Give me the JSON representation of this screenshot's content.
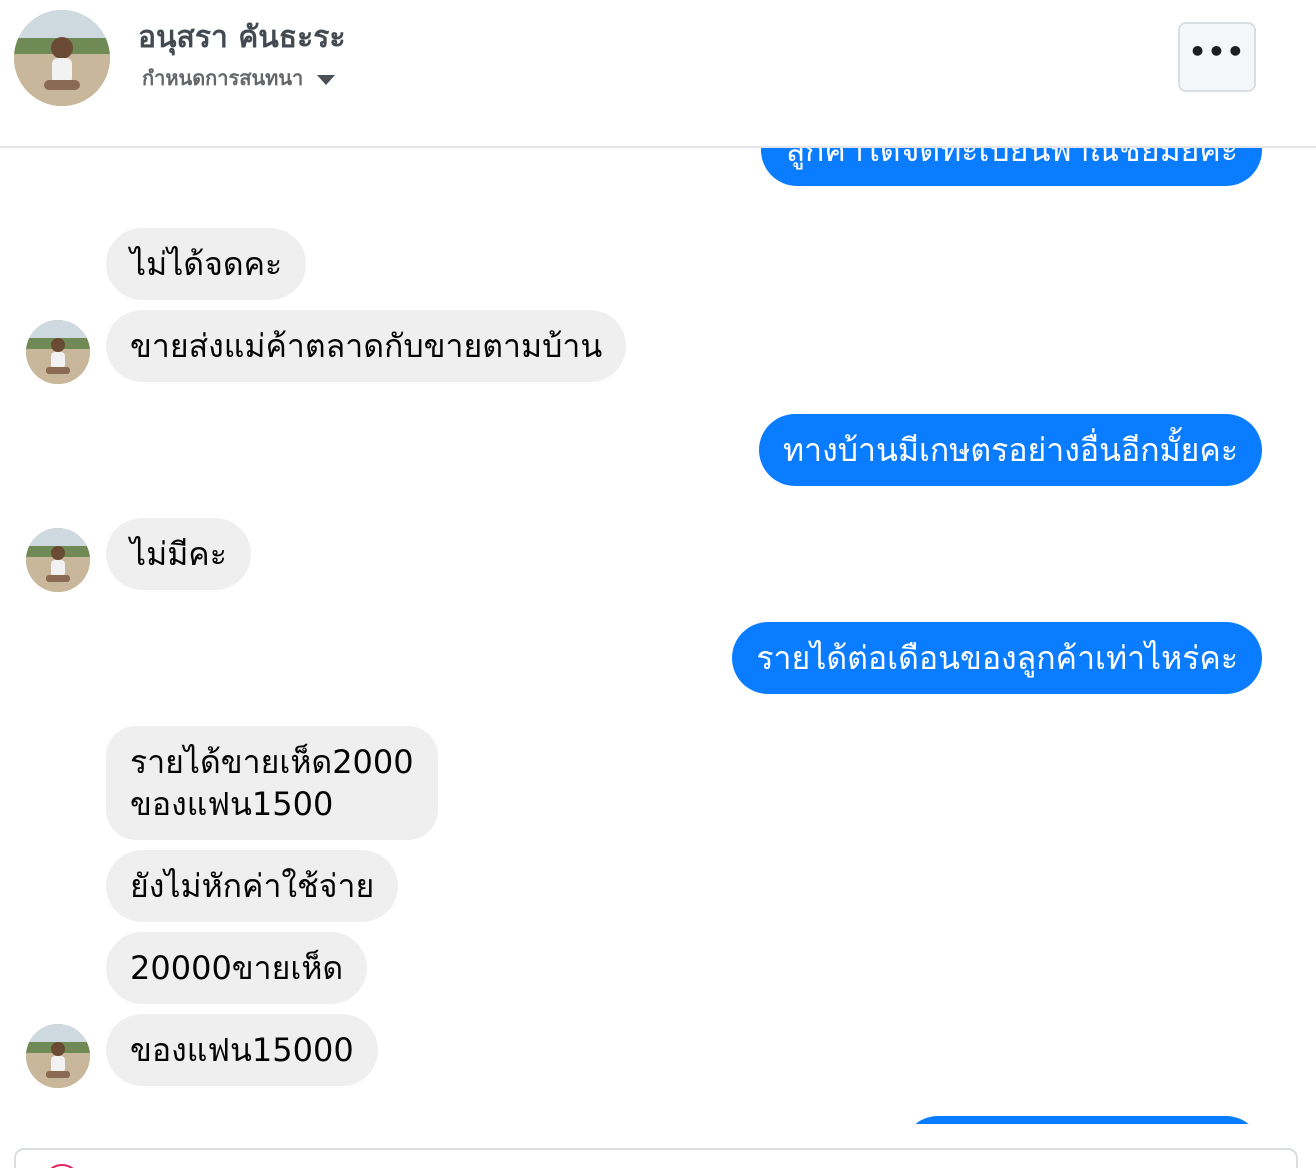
{
  "header": {
    "name": "อนุสรา คันธะระ",
    "subtitle": "กำหนดการสนทนา",
    "more_label": "•••"
  },
  "messages": [
    {
      "direction": "out",
      "text": "ลูกค้าได้จดทะเบียนพาณิชย์มั้ยคะ"
    },
    {
      "direction": "in",
      "text": "ไม่ได้จดคะ"
    },
    {
      "direction": "in",
      "text": "ขายส่งแม่ค้าตลาดกับขายตามบ้าน"
    },
    {
      "direction": "out",
      "text": "ทางบ้านมีเกษตรอย่างอื่นอีกมั้ยคะ"
    },
    {
      "direction": "in",
      "text": "ไม่มีคะ"
    },
    {
      "direction": "out",
      "text": "รายได้ต่อเดือนของลูกค้าเท่าไหร่คะ"
    },
    {
      "direction": "in",
      "text_line1": "รายได้ขายเห็ด2000",
      "text_line2": "ของแฟน1500"
    },
    {
      "direction": "in",
      "text": "ยังไม่หักค่าใช้จ่าย"
    },
    {
      "direction": "in",
      "text": "20000ขายเห็ด"
    },
    {
      "direction": "in",
      "text": "ของแฟน15000"
    }
  ],
  "colors": {
    "outgoing_bubble": "#0a7cff",
    "incoming_bubble": "#efefef"
  },
  "icons": {
    "header_avatar": "user-avatar-photo",
    "more": "ellipsis-icon",
    "dropdown": "caret-down-icon"
  }
}
